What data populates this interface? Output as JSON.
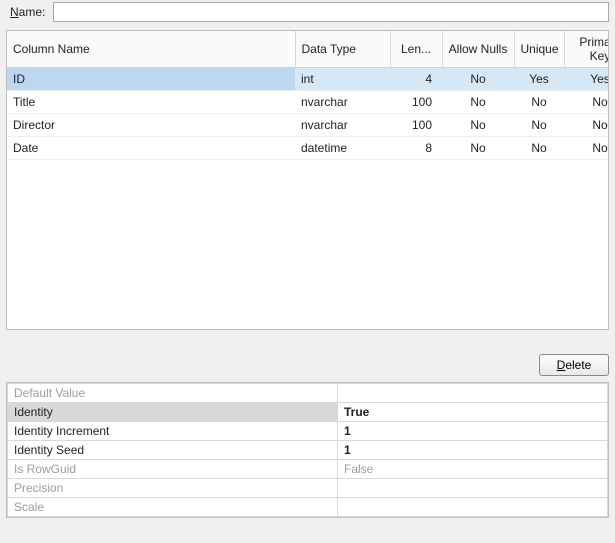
{
  "top": {
    "name_label_pre": "N",
    "name_label_rest": "ame:",
    "name_value": ""
  },
  "grid": {
    "headers": {
      "column_name": "Column Name",
      "data_type": "Data Type",
      "length": "Len...",
      "allow_nulls": "Allow Nulls",
      "unique": "Unique",
      "primary_key": "Primary Key"
    },
    "rows": [
      {
        "name": "ID",
        "type": "int",
        "len": "4",
        "nulls": "No",
        "unique": "Yes",
        "pk": "Yes",
        "selected": true
      },
      {
        "name": "Title",
        "type": "nvarchar",
        "len": "100",
        "nulls": "No",
        "unique": "No",
        "pk": "No",
        "selected": false
      },
      {
        "name": "Director",
        "type": "nvarchar",
        "len": "100",
        "nulls": "No",
        "unique": "No",
        "pk": "No",
        "selected": false
      },
      {
        "name": "Date",
        "type": "datetime",
        "len": "8",
        "nulls": "No",
        "unique": "No",
        "pk": "No",
        "selected": false
      }
    ]
  },
  "buttons": {
    "delete_pre": "D",
    "delete_rest": "elete"
  },
  "props": [
    {
      "key": "Default Value",
      "value": "",
      "state": "disabled"
    },
    {
      "key": "Identity",
      "value": "True",
      "state": "selected"
    },
    {
      "key": "Identity Increment",
      "value": "1",
      "state": "bold"
    },
    {
      "key": "Identity Seed",
      "value": "1",
      "state": "bold"
    },
    {
      "key": "Is RowGuid",
      "value": "False",
      "state": "disabled"
    },
    {
      "key": "Precision",
      "value": "",
      "state": "disabled"
    },
    {
      "key": "Scale",
      "value": "",
      "state": "disabled"
    }
  ]
}
